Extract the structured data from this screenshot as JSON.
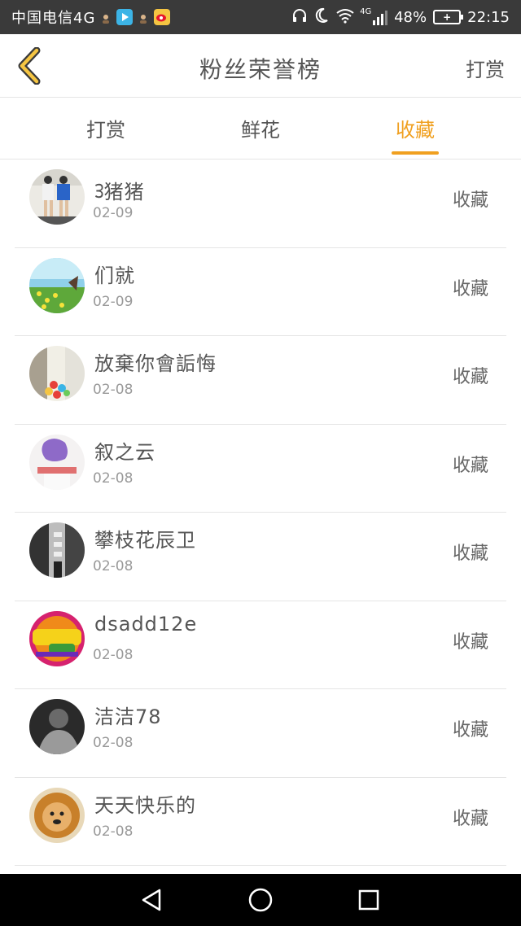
{
  "status_bar": {
    "carrier": "中国电信4G",
    "network": "4G",
    "battery": "48%",
    "time": "22:15"
  },
  "header": {
    "title": "粉丝荣誉榜",
    "action_label": "打赏"
  },
  "tabs": [
    {
      "label": "打赏",
      "active": false
    },
    {
      "label": "鲜花",
      "active": false
    },
    {
      "label": "收藏",
      "active": true
    }
  ],
  "accent_color": "#f0a020",
  "items": [
    {
      "name": "ᢃ猪猪",
      "date": "02-09",
      "action": "收藏"
    },
    {
      "name": "们就",
      "date": "02-09",
      "action": "收藏"
    },
    {
      "name": "放棄你會詬悔",
      "date": "02-08",
      "action": "收藏"
    },
    {
      "name": "叙之云",
      "date": "02-08",
      "action": "收藏"
    },
    {
      "name": "攀枝花辰卫",
      "date": "02-08",
      "action": "收藏"
    },
    {
      "name": "dsadd12e",
      "date": "02-08",
      "action": "收藏"
    },
    {
      "name": "洁洁78",
      "date": "02-08",
      "action": "收藏"
    },
    {
      "name": "天天快乐的",
      "date": "02-08",
      "action": "收藏"
    }
  ]
}
